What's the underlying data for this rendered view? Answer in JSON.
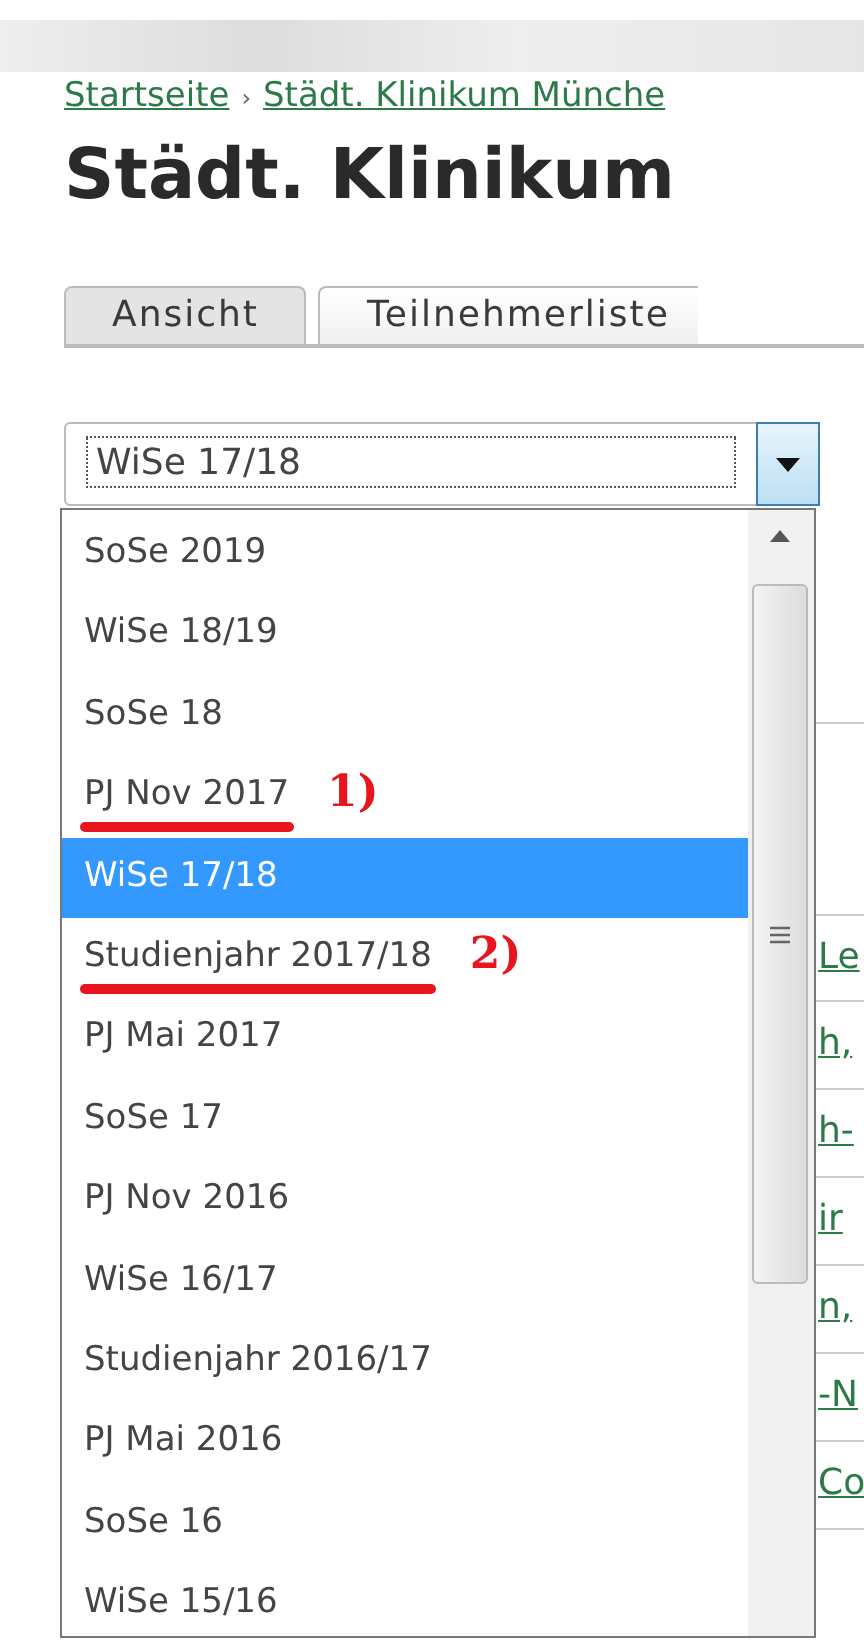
{
  "breadcrumb": [
    {
      "label": "Startseite"
    },
    {
      "label": "Städt. Klinikum Münche"
    }
  ],
  "breadcrumb_separator": "›",
  "title": "Städt. Klinikum",
  "tabs": [
    {
      "label": "Ansicht",
      "selected": true
    },
    {
      "label": "Teilnehmerliste",
      "selected": false
    }
  ],
  "select": {
    "value": "WiSe 17/18",
    "expanded": true
  },
  "options": [
    {
      "label": "SoSe 2019",
      "selected": false
    },
    {
      "label": "WiSe 18/19",
      "selected": false
    },
    {
      "label": "SoSe 18",
      "selected": false
    },
    {
      "label": "PJ Nov 2017",
      "selected": false,
      "annotation": "1)"
    },
    {
      "label": "WiSe 17/18",
      "selected": true
    },
    {
      "label": "Studienjahr 2017/18",
      "selected": false,
      "annotation": "2)"
    },
    {
      "label": "PJ Mai 2017",
      "selected": false
    },
    {
      "label": "SoSe 17",
      "selected": false
    },
    {
      "label": "PJ Nov 2016",
      "selected": false
    },
    {
      "label": "WiSe 16/17",
      "selected": false
    },
    {
      "label": "Studienjahr 2016/17",
      "selected": false
    },
    {
      "label": "PJ Mai 2016",
      "selected": false
    },
    {
      "label": "SoSe 16",
      "selected": false
    },
    {
      "label": "WiSe 15/16",
      "selected": false
    }
  ],
  "table_links": [
    "Le",
    "h,",
    "h-",
    "ir",
    "n,",
    "-N",
    "Co"
  ]
}
